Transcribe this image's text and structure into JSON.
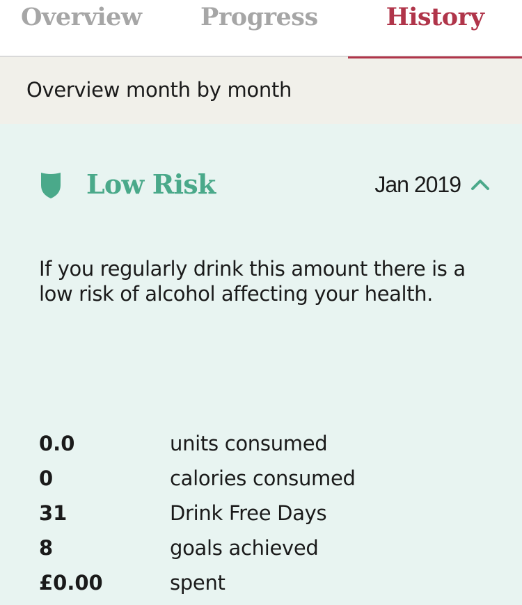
{
  "tabs": [
    {
      "label": "Overview"
    },
    {
      "label": "Progress"
    },
    {
      "label": "History"
    }
  ],
  "active_tab": "History",
  "subheader": {
    "title": "Overview month by month"
  },
  "risk": {
    "icon": "shield-icon",
    "title": "Low Risk",
    "month": "Jan 2019",
    "expand_icon": "chevron-up-icon",
    "description": "If you regularly drink this amount there is a low risk of alcohol affecting your health."
  },
  "stats": [
    {
      "value": "0.0",
      "label": "units consumed"
    },
    {
      "value": "0",
      "label": "calories consumed"
    },
    {
      "value": "31",
      "label": "Drink Free Days"
    },
    {
      "value": "8",
      "label": "goals achieved"
    },
    {
      "value": "£0.00",
      "label": "spent"
    }
  ],
  "colors": {
    "accent": "#b0354a",
    "risk_green": "#4aa98a",
    "panel_bg": "#e8f4f1",
    "subheader_bg": "#f1f0ea",
    "inactive_tab": "#a6a6a6"
  }
}
